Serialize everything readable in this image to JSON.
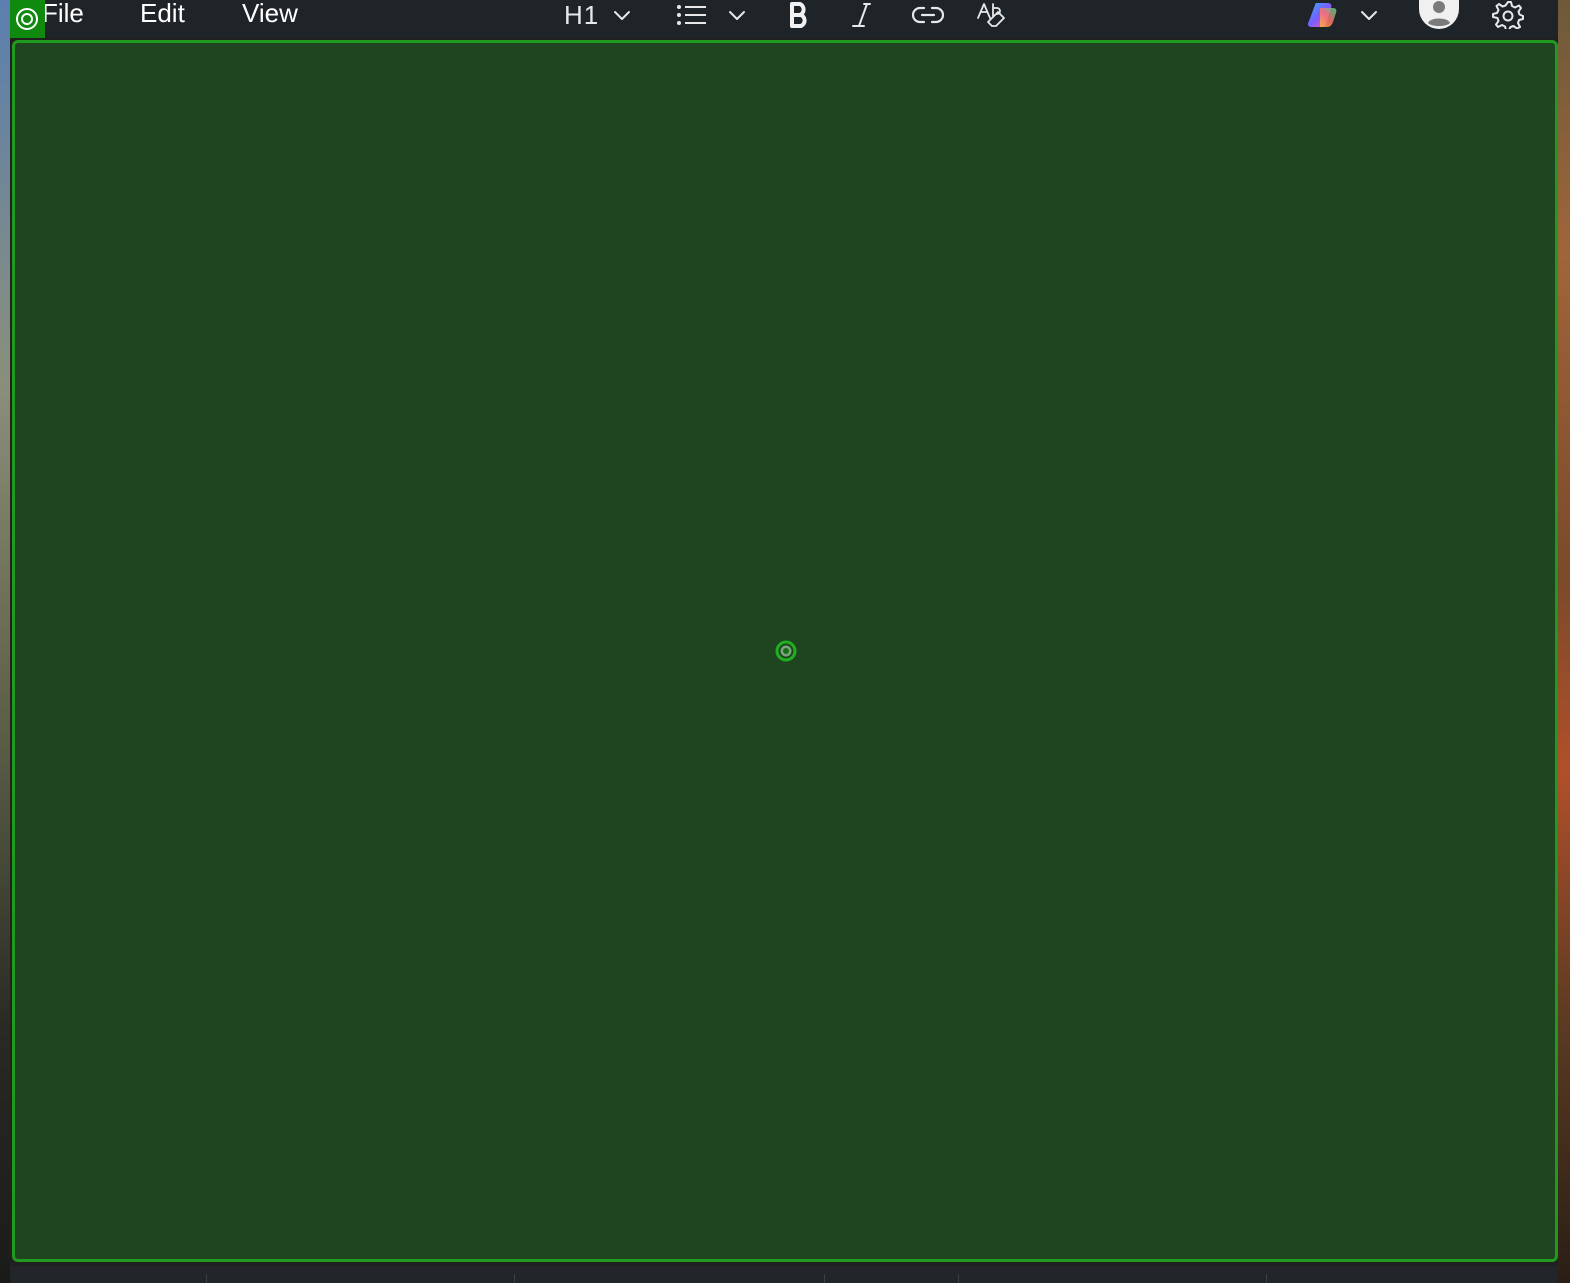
{
  "menubar": {
    "file": "File",
    "edit": "Edit",
    "view": "View"
  },
  "toolbar": {
    "heading_label": "H1",
    "heading_icon": "chevron-down-icon",
    "list_icon": "bulleted-list-icon",
    "bold_icon": "bold-icon",
    "italic_icon": "italic-icon",
    "link_icon": "link-icon",
    "spellcheck_icon": "spellcheck-icon",
    "copilot_icon": "copilot-icon",
    "account_icon": "avatar-icon",
    "settings_icon": "gear-icon"
  },
  "editor": {
    "content": "",
    "background": "#1f4520",
    "border_color": "#1f9a1f"
  },
  "colors": {
    "menubar": "#1f2429",
    "accent_green": "#0f8a0f"
  }
}
